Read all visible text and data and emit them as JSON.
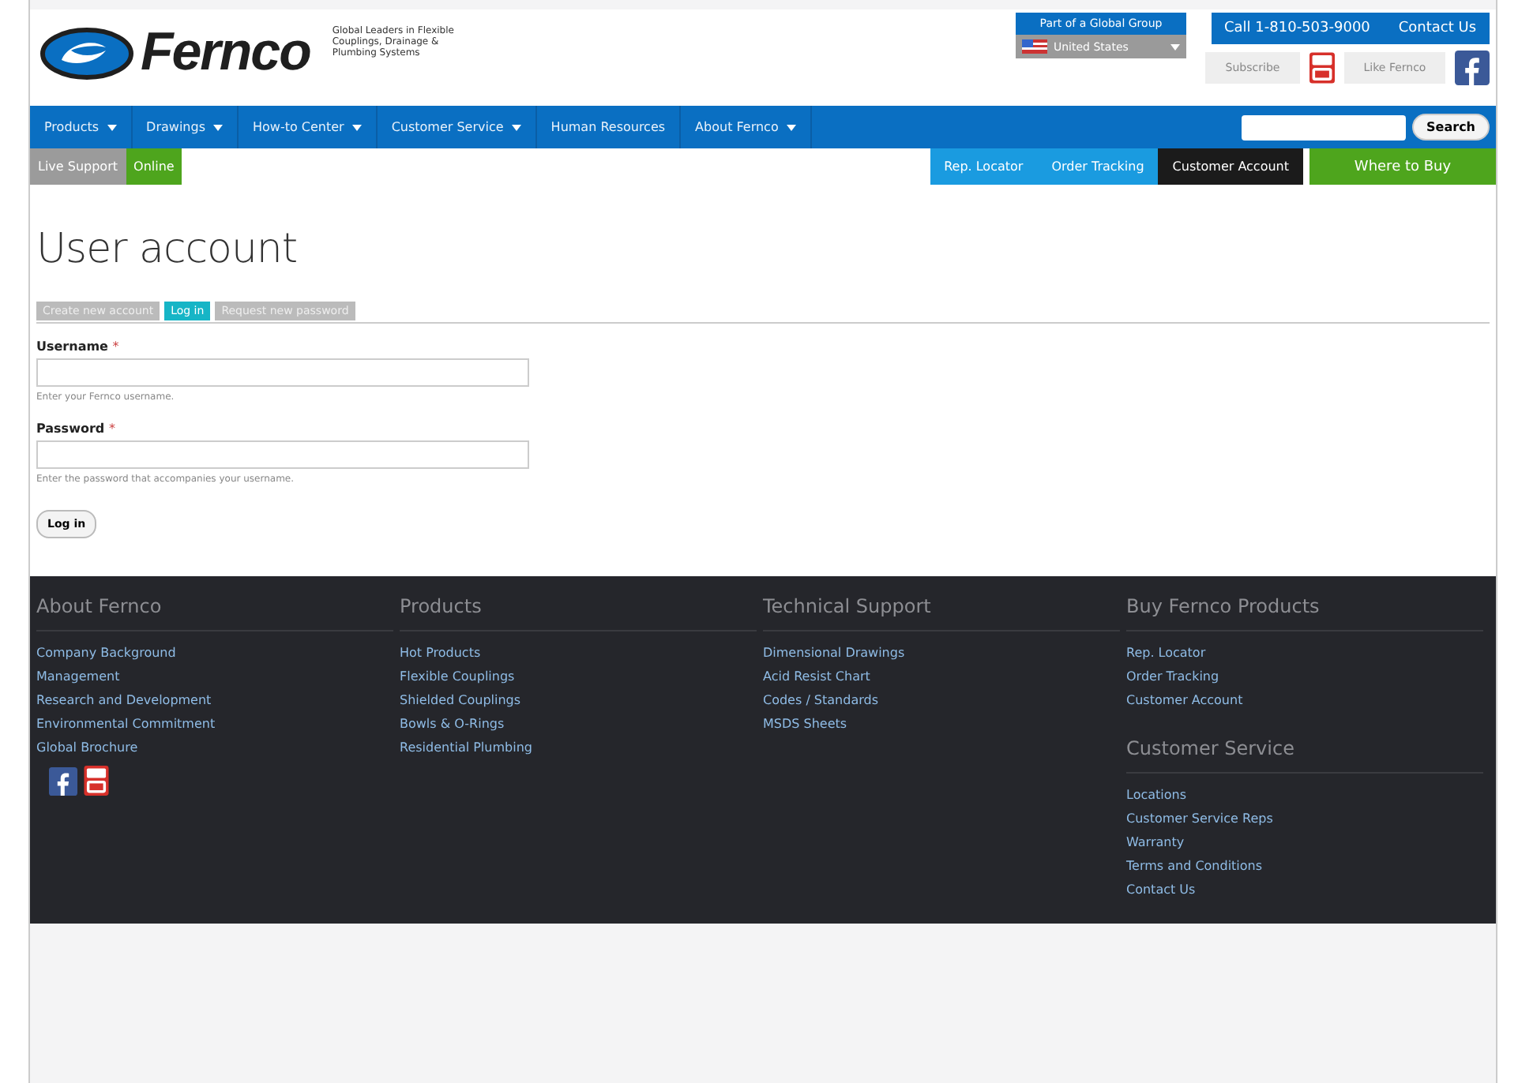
{
  "header": {
    "logo_text": "Fernco",
    "tagline": "Global Leaders in Flexible Couplings, Drainage & Plumbing Systems",
    "group_label": "Part of a Global Group",
    "country": "United States",
    "phone": "Call 1-810-503-9000",
    "contact": "Contact Us",
    "subscribe": "Subscribe",
    "like": "Like Fernco"
  },
  "nav": {
    "items": [
      {
        "label": "Products",
        "has_menu": true
      },
      {
        "label": "Drawings",
        "has_menu": true
      },
      {
        "label": "How-to Center",
        "has_menu": true
      },
      {
        "label": "Customer Service",
        "has_menu": true
      },
      {
        "label": "Human Resources",
        "has_menu": false
      },
      {
        "label": "About Fernco",
        "has_menu": true
      }
    ],
    "search_button": "Search"
  },
  "live_support": {
    "label": "Live Support",
    "status": "Online",
    "online": true
  },
  "quick_links": [
    {
      "label": "Rep. Locator",
      "color": "#1a9be0"
    },
    {
      "label": "Order Tracking",
      "color": "#1a9be0"
    },
    {
      "label": "Customer Account",
      "color": "#1b1b1b"
    },
    {
      "label": "Where to Buy",
      "color": "#4ea51d"
    }
  ],
  "page_title": "User account",
  "tabs": [
    {
      "label": "Create new account",
      "selected": false
    },
    {
      "label": "Log in",
      "selected": true
    },
    {
      "label": "Request new password",
      "selected": false
    }
  ],
  "form": {
    "fields": [
      {
        "label": "Username",
        "required_mark": "*",
        "description": "Enter your Fernco username."
      },
      {
        "label": "Password",
        "required_mark": "*",
        "description": "Enter the password that accompanies your username."
      }
    ],
    "submit": "Log in"
  },
  "footer": {
    "columns": [
      {
        "sections": [
          {
            "title": "About Fernco",
            "links": [
              "Company Background",
              "Management",
              "Research and Development",
              "Environmental Commitment",
              "Global Brochure"
            ]
          }
        ],
        "social": true
      },
      {
        "sections": [
          {
            "title": "Products",
            "links": [
              "Hot Products",
              "Flexible Couplings",
              "Shielded Couplings",
              "Bowls & O-Rings",
              "Residential Plumbing"
            ]
          }
        ],
        "social": false
      },
      {
        "sections": [
          {
            "title": "Technical Support",
            "links": [
              "Dimensional Drawings",
              "Acid Resist Chart",
              "Codes / Standards",
              "MSDS Sheets"
            ]
          }
        ],
        "social": false
      },
      {
        "sections": [
          {
            "title": "Buy Fernco Products",
            "links": [
              "Rep. Locator",
              "Order Tracking",
              "Customer Account"
            ]
          },
          {
            "title": "Customer Service",
            "links": [
              "Locations",
              "Customer Service Reps",
              "Warranty",
              "Terms and Conditions",
              "Contact Us"
            ]
          }
        ],
        "social": false
      }
    ]
  }
}
